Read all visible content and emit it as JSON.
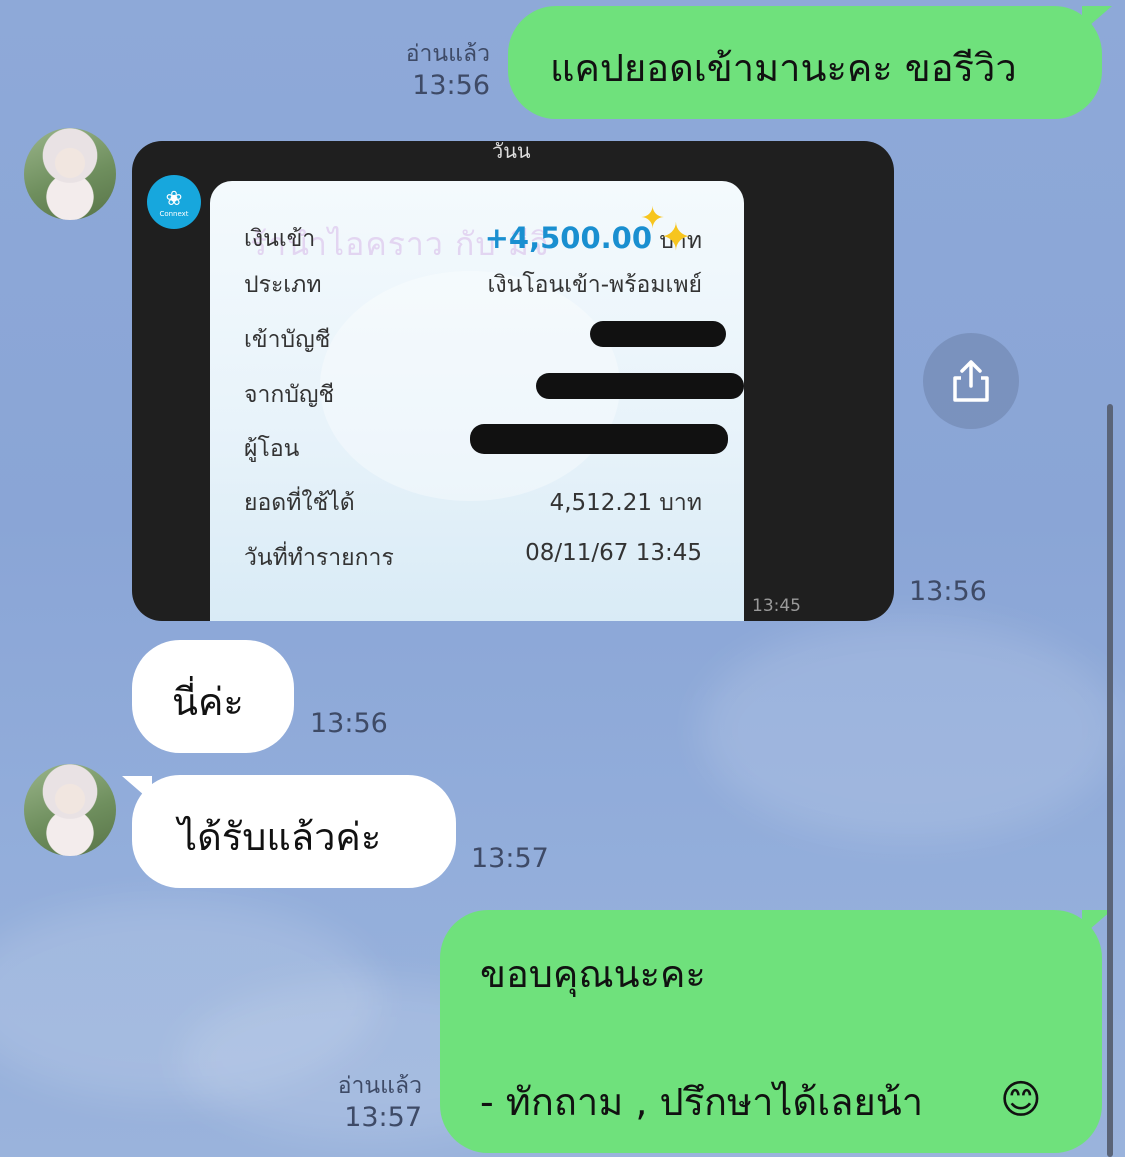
{
  "messages": [
    {
      "from": "me",
      "text": "แคปยอดเข้ามานะคะ ขอรีวิว",
      "read_label": "อ่านแล้ว",
      "time": "13:56"
    },
    {
      "from": "them",
      "type": "image",
      "time": "13:56",
      "slip": {
        "top_fragment": "วันน",
        "bank_logo_label": "Connext",
        "watermark": "ร้านำไอคราว กับ มีจิ",
        "rows": [
          {
            "label": "เงินเข้า",
            "value": "+4,500.00",
            "unit": "บาท"
          },
          {
            "label": "ประเภท",
            "value": "เงินโอนเข้า-พร้อมเพย์"
          },
          {
            "label": "เข้าบัญชี",
            "value": ""
          },
          {
            "label": "จากบัญชี",
            "value": ""
          },
          {
            "label": "ผู้โอน",
            "value": ""
          },
          {
            "label": "ยอดที่ใช้ได้",
            "value": "4,512.21 บาท"
          },
          {
            "label": "วันที่ทำรายการ",
            "value": "08/11/67 13:45"
          }
        ],
        "image_time": "13:45"
      }
    },
    {
      "from": "them",
      "text": "นี่ค่ะ",
      "time": "13:56"
    },
    {
      "from": "them",
      "text": "ได้รับแล้วค่ะ",
      "time": "13:57"
    },
    {
      "from": "me",
      "text_line1": "ขอบคุณนะคะ",
      "text_line2": "- ทักถาม , ปรึกษาได้เลยน้า",
      "emoji": "😊",
      "read_label": "อ่านแล้ว",
      "time": "13:57"
    }
  ],
  "icons": {
    "share": "share-icon",
    "avatar": "avatar-image"
  },
  "colors": {
    "my_bubble": "#6fe17c",
    "their_bubble": "#ffffff",
    "background": "#8ea9d8"
  }
}
